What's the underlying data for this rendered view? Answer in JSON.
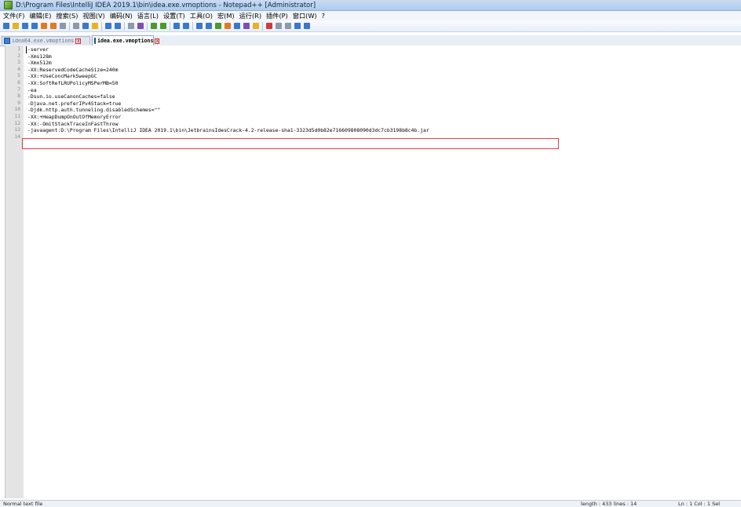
{
  "window": {
    "title": "D:\\Program Files\\IntelliJ IDEA 2019.1\\bin\\idea.exe.vmoptions - Notepad++ [Administrator]"
  },
  "menu": [
    "文件(F)",
    "编辑(E)",
    "搜索(S)",
    "视图(V)",
    "编码(N)",
    "语言(L)",
    "设置(T)",
    "工具(O)",
    "宏(M)",
    "运行(R)",
    "插件(P)",
    "窗口(W)",
    "?"
  ],
  "toolbar": {
    "icons": [
      "new-file",
      "open-file",
      "save",
      "save-all",
      "close",
      "close-all",
      "print",
      "cut",
      "copy",
      "paste",
      "undo",
      "redo",
      "find",
      "replace",
      "zoom-in",
      "zoom-out",
      "sync-v",
      "sync-h",
      "word-wrap",
      "show-all",
      "indent-guide",
      "udl",
      "doc-map",
      "function-list",
      "folder-workspace",
      "record-macro",
      "stop-record",
      "play-macro",
      "run-macro-multiple",
      "save-macro"
    ],
    "colors": {
      "blue": "#3a78c9",
      "green": "#4c9a2a",
      "yellow": "#e5b425",
      "red": "#d23a3a",
      "gray": "#8d99a8",
      "purple": "#7b4fb8",
      "orange": "#e07b22"
    }
  },
  "tabs": [
    {
      "label": "idea64.exe.vmoptions",
      "active": false
    },
    {
      "label": "idea.exe.vmoptions",
      "active": true
    }
  ],
  "editor": {
    "lines": [
      {
        "num": "1",
        "text": "-server"
      },
      {
        "num": "2",
        "text": "-Xms128m"
      },
      {
        "num": "3",
        "text": "-Xmx512m"
      },
      {
        "num": "4",
        "text": "-XX:ReservedCodeCacheSize=240m"
      },
      {
        "num": "5",
        "text": "-XX:+UseConcMarkSweepGC"
      },
      {
        "num": "6",
        "text": "-XX:SoftRefLRUPolicyMSPerMB=50"
      },
      {
        "num": "7",
        "text": "-ea"
      },
      {
        "num": "8",
        "text": "-Dsun.io.useCanonCaches=false"
      },
      {
        "num": "9",
        "text": "-Djava.net.preferIPv4Stack=true"
      },
      {
        "num": "10",
        "text": "-Djdk.http.auth.tunneling.disabledSchemes=\"\""
      },
      {
        "num": "11",
        "text": "-XX:+HeapDumpOnOutOfMemoryError"
      },
      {
        "num": "12",
        "text": "-XX:-OmitStackTraceInFastThrow"
      },
      {
        "num": "13",
        "text": "-javaagent:D:\\Program Files\\IntelliJ IDEA 2019.1\\bin\\JetbrainsIdesCrack-4.2-release-sha1-3323d5d0b82e716609808090d3dc7cb3198b8c4b.jar"
      },
      {
        "num": "14",
        "text": ""
      }
    ],
    "highlight_color": "#e8404a"
  },
  "status": {
    "file_type": "Normal text file",
    "length_lines": "length : 433    lines : 14",
    "position": "Ln : 1    Col : 1    Sel"
  }
}
